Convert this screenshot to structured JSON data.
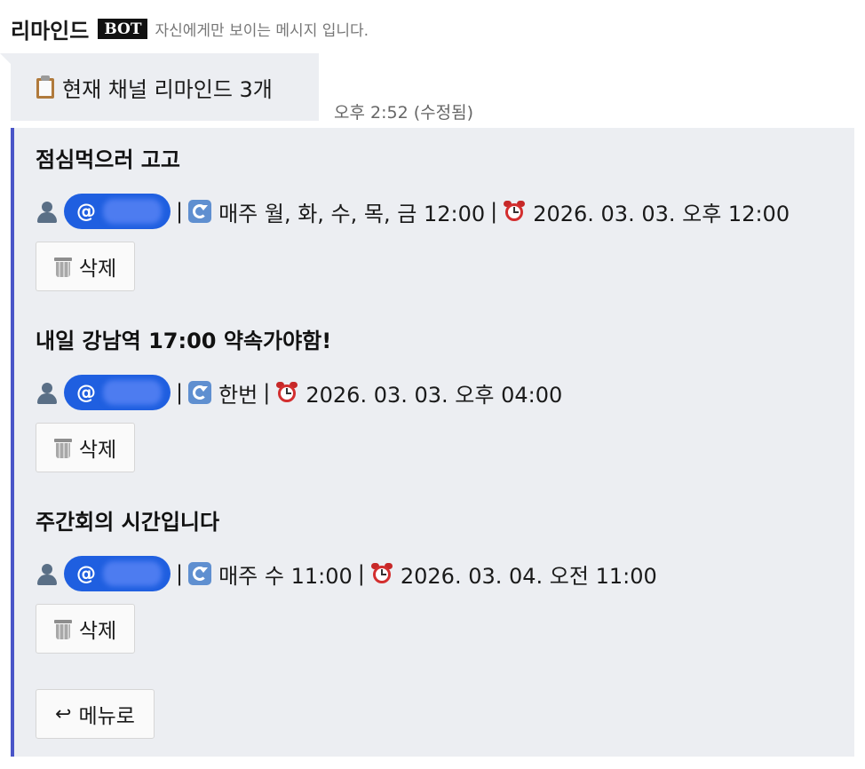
{
  "header": {
    "bot_name": "리마인드",
    "badge": "BOT",
    "ephemeral_note": "자신에게만 보이는 메시지 입니다."
  },
  "message": {
    "summary": "현재 채널 리마인드 3개",
    "timestamp": "오후 2:52",
    "edited": "(수정됨)"
  },
  "reminders": [
    {
      "title": "점심먹으러 고고",
      "mention_prefix": "@",
      "repeat": "매주 월, 화, 수, 목, 금 12:00",
      "next_time": "2026. 03. 03. 오후 12:00",
      "delete_label": "삭제"
    },
    {
      "title": "내일 강남역 17:00 약속가야함!",
      "mention_prefix": "@",
      "repeat": "한번",
      "next_time": "2026. 03. 03. 오후 04:00",
      "delete_label": "삭제"
    },
    {
      "title": "주간회의 시간입니다",
      "mention_prefix": "@",
      "repeat": "매주 수 11:00",
      "next_time": "2026. 03. 04. 오전 11:00",
      "delete_label": "삭제"
    }
  ],
  "separator": "|",
  "menu_button": {
    "icon": "↩",
    "label": "메뉴로"
  },
  "colors": {
    "card_background": "#eceef2",
    "accent_bar": "#4a55c8",
    "mention_pill": "#1f5fe0"
  },
  "icons": {
    "summary": "clipboard-icon",
    "user": "user-icon",
    "repeat": "repeat-icon",
    "time": "alarm-clock-icon",
    "delete": "trash-icon",
    "menu": "return-arrow-icon"
  }
}
